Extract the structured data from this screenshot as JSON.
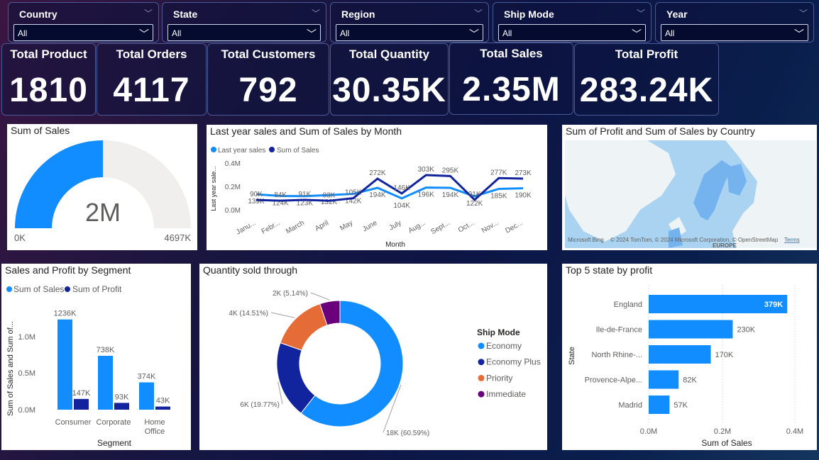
{
  "slicers": [
    {
      "title": "Country",
      "value": "All"
    },
    {
      "title": "State",
      "value": "All"
    },
    {
      "title": "Region",
      "value": "All"
    },
    {
      "title": "Ship Mode",
      "value": "All"
    },
    {
      "title": "Year",
      "value": "All"
    }
  ],
  "kpis": [
    {
      "label": "Total Product",
      "value": "1810"
    },
    {
      "label": "Total Orders",
      "value": "4117"
    },
    {
      "label": "Total Customers",
      "value": "792"
    },
    {
      "label": "Total Quantity",
      "value": "30.35K"
    },
    {
      "label": "Total Sales",
      "value": "2.35M"
    },
    {
      "label": "Total Profit",
      "value": "283.24K"
    }
  ],
  "colors": {
    "sales": "#118dff",
    "profit": "#12239e",
    "priority": "#e66c37",
    "immediate": "#6b007b",
    "gauge_bg": "#f0efee"
  },
  "map": {
    "title": "Sum of Profit and Sum of Sales by Country",
    "attribution": "© 2024 TomTom, © 2024 Microsoft Corporation, © OpenStreetMap",
    "terms": "Terms",
    "bing": "Microsoft Bing",
    "region_label": "EUROPE"
  },
  "chart_data": [
    {
      "type": "gauge",
      "title": "Sum of Sales",
      "value_label": "2M",
      "min_label": "0K",
      "max_label": "4697K",
      "value": 2350000,
      "min": 0,
      "max": 4697000
    },
    {
      "type": "line",
      "title": "Last year sales and Sum of Sales by Month",
      "xlabel": "Month",
      "ylabel": "Last year sale...",
      "yticks": [
        "0.0M",
        "0.2M",
        "0.4M"
      ],
      "ylim": [
        0,
        400000
      ],
      "categories": [
        "Janu...",
        "Febr...",
        "March",
        "April",
        "May",
        "June",
        "July",
        "Aug...",
        "Sept...",
        "Oct...",
        "Nov...",
        "Dec..."
      ],
      "series": [
        {
          "name": "Last year sales",
          "values": [
            139000,
            124000,
            123000,
            132000,
            142000,
            194000,
            104000,
            196000,
            194000,
            122000,
            185000,
            190000
          ],
          "labels": [
            "139K",
            "124K",
            "123K",
            "132K",
            "142K",
            "194K",
            "104K",
            "196K",
            "194K",
            "122K",
            "185K",
            "190K"
          ]
        },
        {
          "name": "Sum of Sales",
          "values": [
            90000,
            84000,
            91000,
            83000,
            105000,
            272000,
            146000,
            303000,
            295000,
            91000,
            277000,
            273000
          ],
          "labels": [
            "90K",
            "84K",
            "91K",
            "83K",
            "105K",
            "272K",
            "146K",
            "303K",
            "295K",
            "91K",
            "277K",
            "273K"
          ]
        }
      ]
    },
    {
      "type": "bar",
      "title": "Sales and Profit by Segment",
      "xlabel": "Segment",
      "ylabel": "Sum of Sales and Sum of...",
      "yticks": [
        "0.0M",
        "0.5M",
        "1.0M"
      ],
      "ylim": [
        0,
        1400000
      ],
      "categories": [
        "Consumer",
        "Corporate",
        "Home Office"
      ],
      "series": [
        {
          "name": "Sum of Sales",
          "values": [
            1236000,
            738000,
            374000
          ],
          "labels": [
            "1236K",
            "738K",
            "374K"
          ]
        },
        {
          "name": "Sum of Profit",
          "values": [
            147000,
            93000,
            43000
          ],
          "labels": [
            "147K",
            "93K",
            "43K"
          ]
        }
      ]
    },
    {
      "type": "pie",
      "title": "Quantity sold through",
      "legend_title": "Ship Mode",
      "slices": [
        {
          "name": "Economy",
          "value": 18000,
          "pct": 60.59,
          "label": "18K (60.59%)"
        },
        {
          "name": "Economy Plus",
          "value": 6000,
          "pct": 19.77,
          "label": "6K (19.77%)"
        },
        {
          "name": "Priority",
          "value": 4000,
          "pct": 14.51,
          "label": "4K (14.51%)"
        },
        {
          "name": "Immediate",
          "value": 2000,
          "pct": 5.14,
          "label": "2K (5.14%)"
        }
      ]
    },
    {
      "type": "bar",
      "orientation": "horizontal",
      "title": "Top 5 state by profit",
      "xlabel": "Sum of Sales",
      "ylabel": "State",
      "xticks": [
        "0.0M",
        "0.2M",
        "0.4M"
      ],
      "xlim": [
        0,
        400000
      ],
      "categories": [
        "England",
        "Ile-de-France",
        "North Rhine-...",
        "Provence-Alpe...",
        "Madrid"
      ],
      "values": [
        379000,
        230000,
        170000,
        82000,
        57000
      ],
      "labels": [
        "379K",
        "230K",
        "170K",
        "82K",
        "57K"
      ]
    }
  ]
}
